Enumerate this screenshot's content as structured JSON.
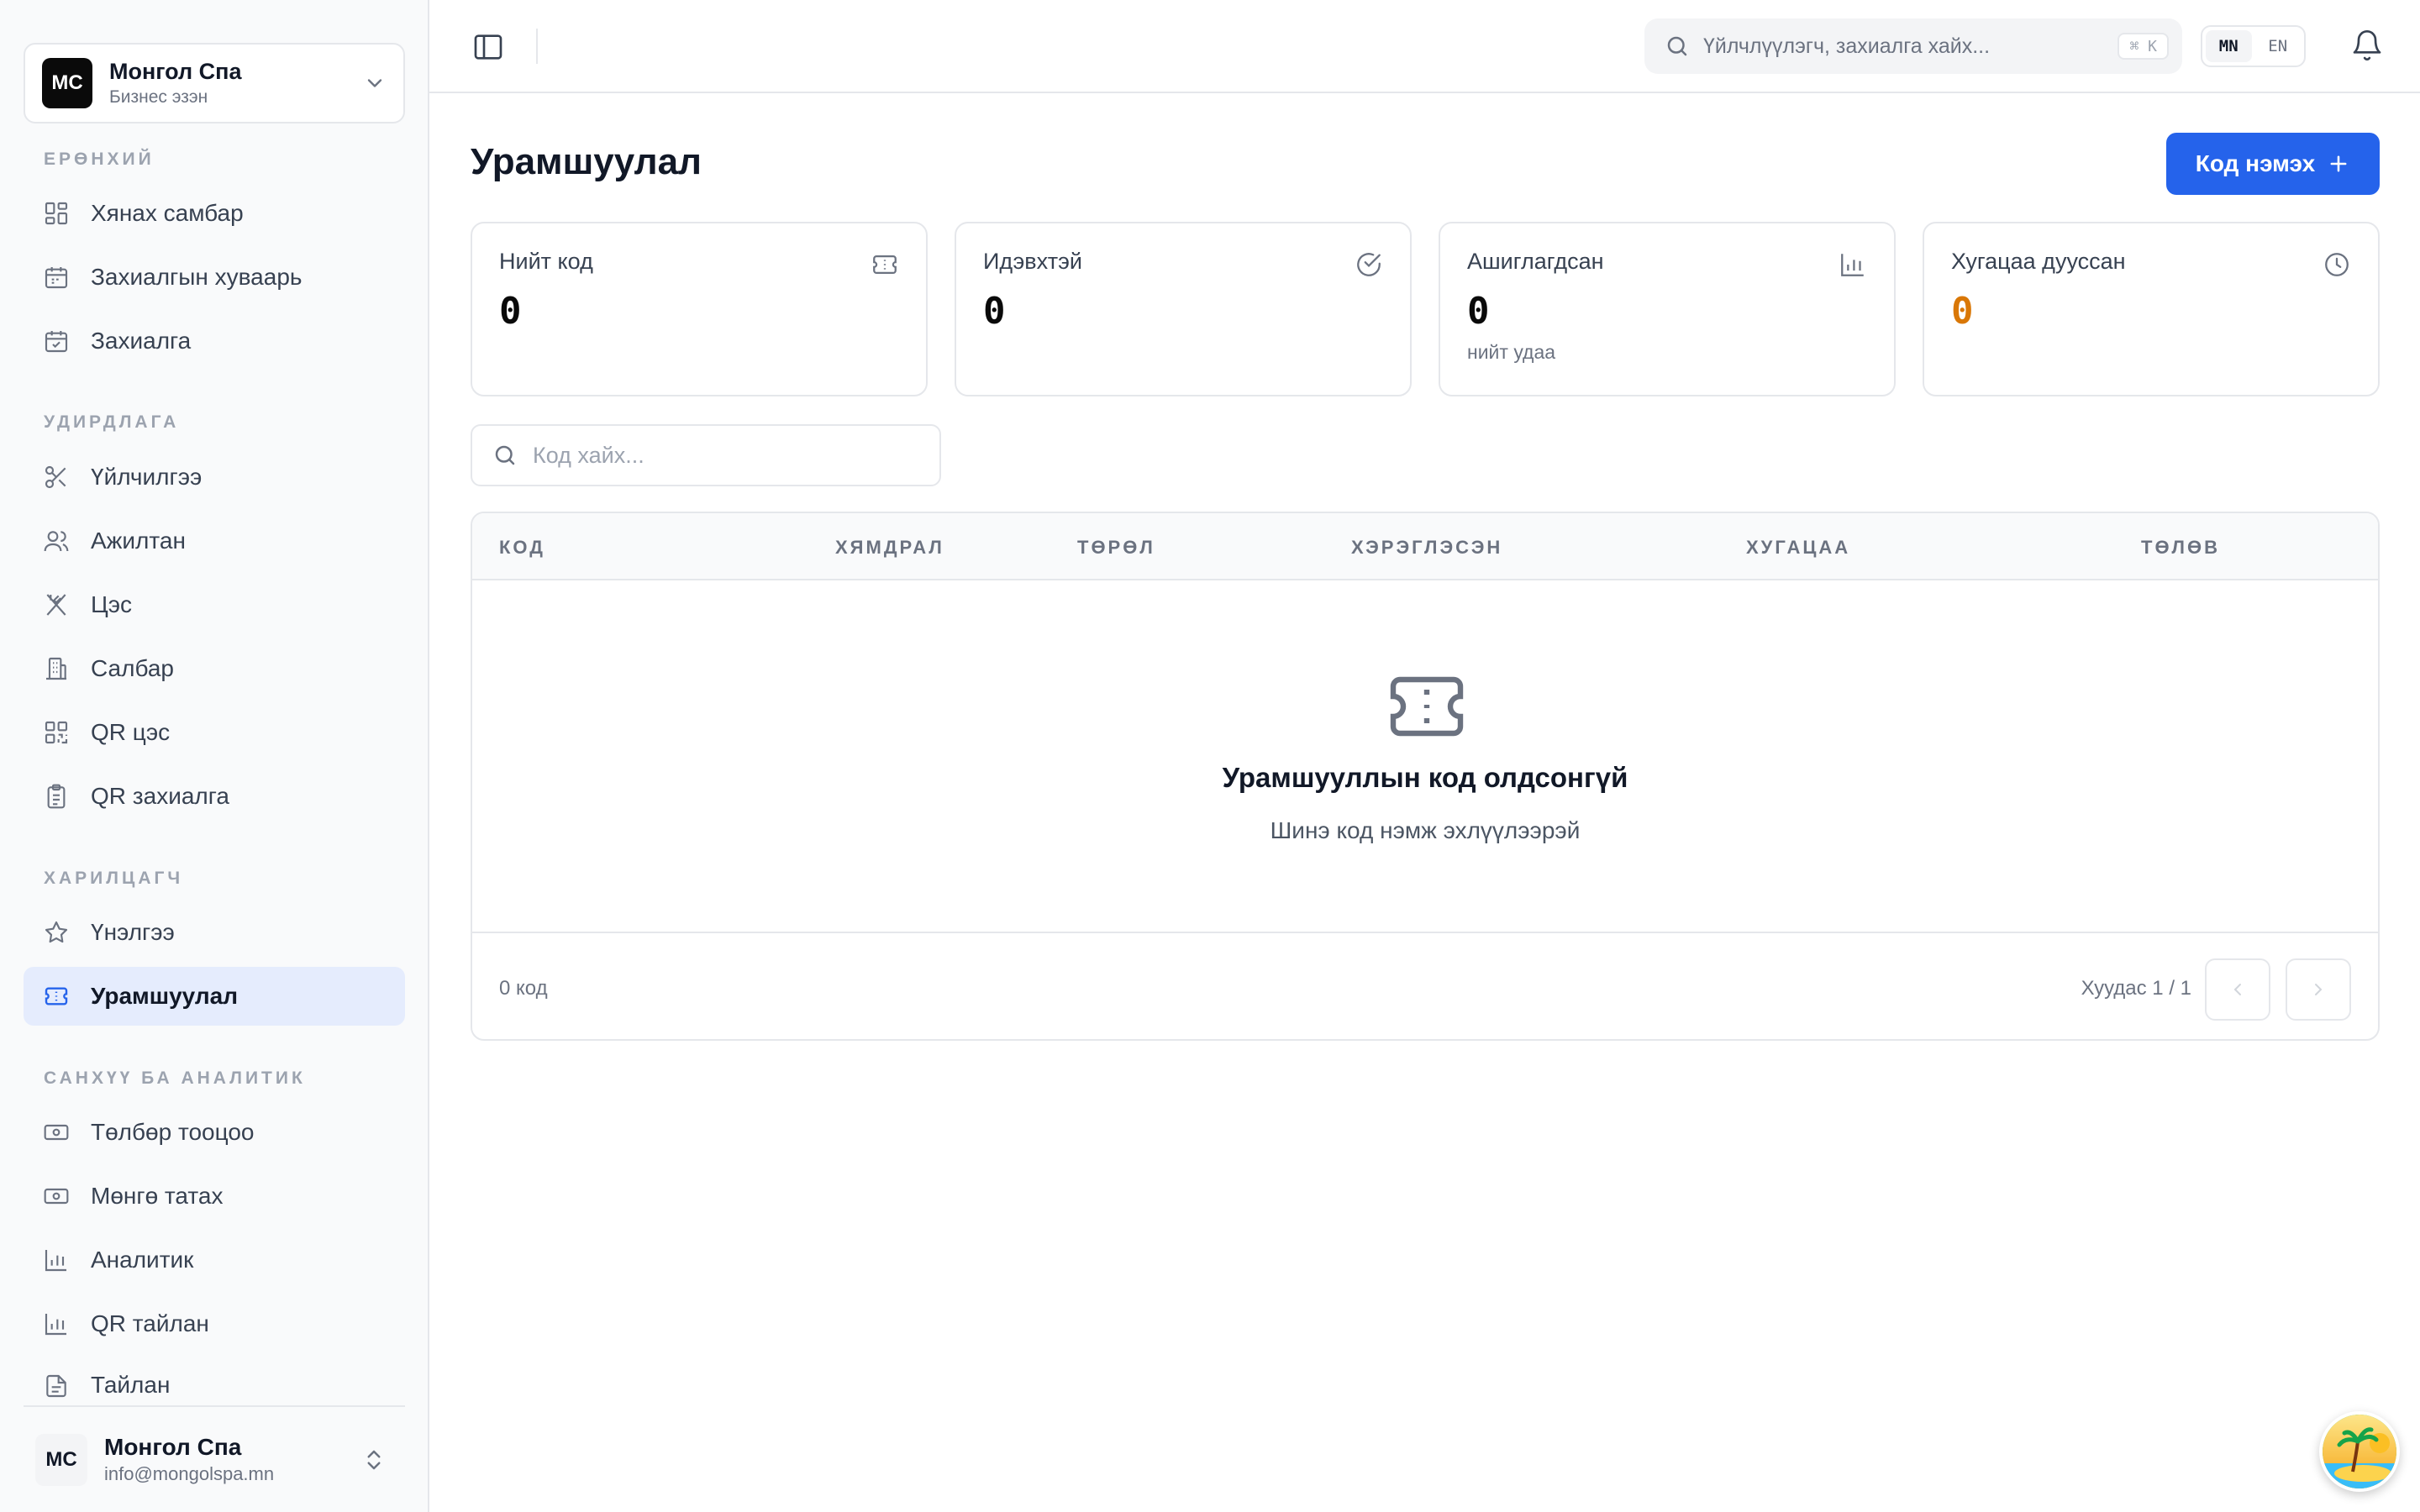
{
  "business": {
    "avatar": "MC",
    "name": "Монгол Спа",
    "role": "Бизнес эзэн"
  },
  "nav": {
    "general_title": "ЕРӨНХИЙ",
    "general": [
      {
        "label": "Хянах самбар",
        "icon": "dashboard-icon"
      },
      {
        "label": "Захиалгын хуваарь",
        "icon": "calendar-icon"
      },
      {
        "label": "Захиалга",
        "icon": "calendar-check-icon"
      }
    ],
    "manage_title": "УДИРДЛАГА",
    "manage": [
      {
        "label": "Үйлчилгээ",
        "icon": "scissors-icon"
      },
      {
        "label": "Ажилтан",
        "icon": "users-icon"
      },
      {
        "label": "Цэс",
        "icon": "utensils-icon"
      },
      {
        "label": "Салбар",
        "icon": "building-icon"
      },
      {
        "label": "QR цэс",
        "icon": "qr-icon"
      },
      {
        "label": "QR захиалга",
        "icon": "clipboard-icon"
      }
    ],
    "customer_title": "ХАРИЛЦАГЧ",
    "customer": [
      {
        "label": "Үнэлгээ",
        "icon": "star-icon"
      },
      {
        "label": "Урамшуулал",
        "icon": "ticket-icon",
        "active": true
      }
    ],
    "finance_title": "САНХҮҮ БА АНАЛИТИК",
    "finance": [
      {
        "label": "Төлбөр тооцоо",
        "icon": "banknote-icon"
      },
      {
        "label": "Мөнгө татах",
        "icon": "banknote-icon"
      },
      {
        "label": "Аналитик",
        "icon": "bar-chart-icon"
      },
      {
        "label": "QR тайлан",
        "icon": "bar-chart-icon"
      },
      {
        "label": "Тайлан",
        "icon": "file-icon"
      }
    ]
  },
  "user": {
    "avatar": "MC",
    "name": "Монгол Спа",
    "email": "info@mongolspa.mn"
  },
  "topbar": {
    "search_placeholder": "Үйлчлүүлэгч, захиалга хайх...",
    "shortcut": "⌘ K",
    "lang_mn": "MN",
    "lang_en": "EN"
  },
  "page": {
    "title": "Урамшуулал",
    "add_button": "Код нэмэх"
  },
  "stats": [
    {
      "label": "Нийт код",
      "value": "0",
      "sub": ""
    },
    {
      "label": "Идэвхтэй",
      "value": "0",
      "sub": ""
    },
    {
      "label": "Ашиглагдсан",
      "value": "0",
      "sub": "нийт удаа"
    },
    {
      "label": "Хугацаа дууссан",
      "value": "0",
      "sub": ""
    }
  ],
  "colors": {
    "accent": "#2563eb",
    "warning": "#d97706"
  },
  "code_search_placeholder": "Код хайх...",
  "table": {
    "headers": [
      "КОД",
      "ХЯМДРАЛ",
      "ТӨРӨЛ",
      "ХЭРЭГЛЭСЭН",
      "ХУГАЦАА",
      "ТӨЛӨВ"
    ],
    "empty_title": "Урамшууллын код олдсонгүй",
    "empty_sub": "Шинэ код нэмж эхлүүлээрэй",
    "count": "0 код",
    "page_info": "Хуудас 1 / 1"
  }
}
